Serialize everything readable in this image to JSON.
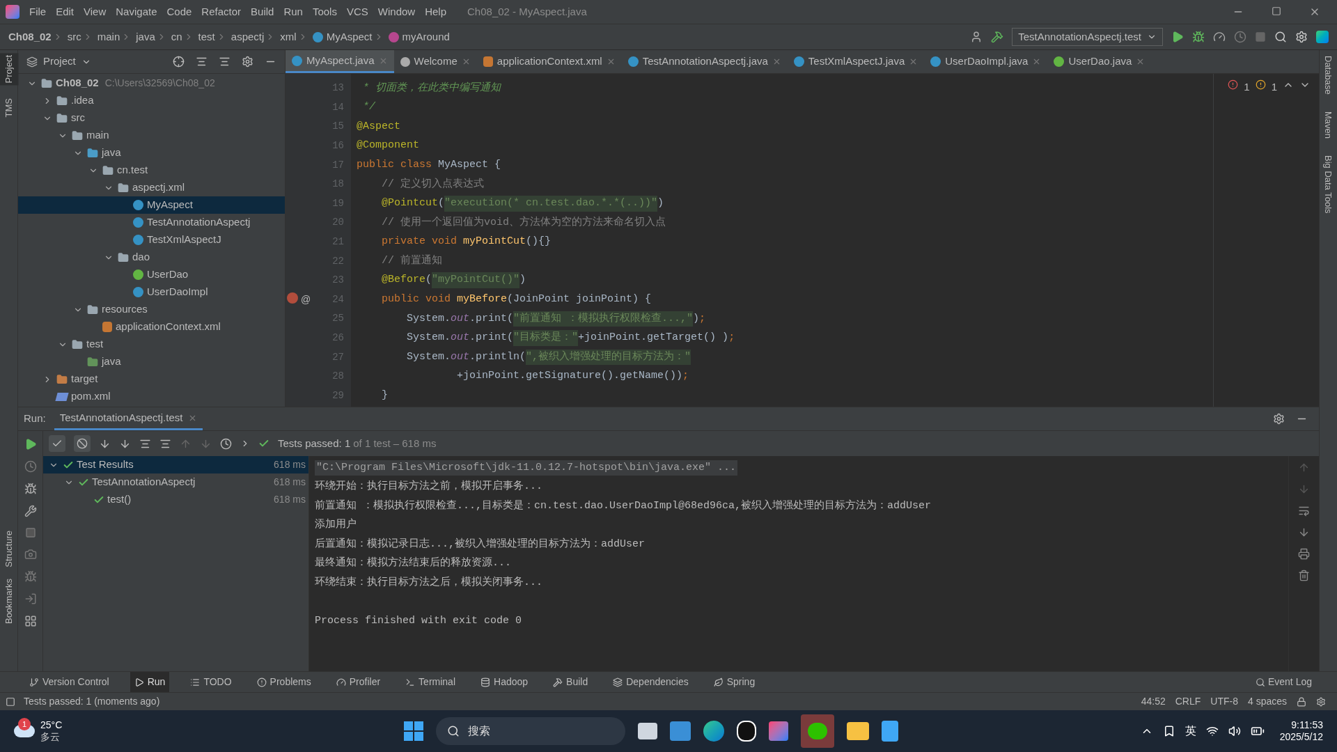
{
  "menu_bar": {
    "items": [
      "File",
      "Edit",
      "View",
      "Navigate",
      "Code",
      "Refactor",
      "Build",
      "Run",
      "Tools",
      "VCS",
      "Window",
      "Help"
    ],
    "title": "Ch08_02 - MyAspect.java"
  },
  "nav_bar": {
    "breadcrumbs": [
      {
        "label": "Ch08_02",
        "kind": "bold"
      },
      {
        "label": "src",
        "kind": "plain"
      },
      {
        "label": "main",
        "kind": "plain"
      },
      {
        "label": "java",
        "kind": "plain"
      },
      {
        "label": "cn",
        "kind": "plain"
      },
      {
        "label": "test",
        "kind": "plain"
      },
      {
        "label": "aspectj",
        "kind": "plain"
      },
      {
        "label": "xml",
        "kind": "plain"
      },
      {
        "label": "MyAspect",
        "kind": "class"
      },
      {
        "label": "myAround",
        "kind": "method"
      }
    ],
    "run_config": "TestAnnotationAspectj.test"
  },
  "left_stripe": {
    "top": [
      "Project",
      "TMS"
    ],
    "bottom": [
      "Structure",
      "Bookmarks"
    ]
  },
  "right_stripe": [
    "Database",
    "Maven",
    "Big Data Tools"
  ],
  "project": {
    "title": "Project",
    "tree": [
      {
        "label": "Ch08_02",
        "path": "C:\\Users\\32569\\Ch08_02",
        "kind": "module",
        "expanded": true,
        "selected": false,
        "children": [
          {
            "label": ".idea",
            "kind": "folder",
            "expanded": false,
            "selected": false
          },
          {
            "label": "src",
            "kind": "folder",
            "expanded": true,
            "selected": false,
            "children": [
              {
                "label": "main",
                "kind": "folder",
                "expanded": true,
                "selected": false,
                "children": [
                  {
                    "label": "java",
                    "kind": "source",
                    "expanded": true,
                    "selected": false,
                    "children": [
                      {
                        "label": "cn.test",
                        "kind": "package",
                        "expanded": true,
                        "selected": false,
                        "children": [
                          {
                            "label": "aspectj.xml",
                            "kind": "package",
                            "expanded": true,
                            "selected": false,
                            "children": [
                              {
                                "label": "MyAspect",
                                "kind": "class",
                                "selected": true
                              },
                              {
                                "label": "TestAnnotationAspectj",
                                "kind": "class",
                                "selected": false
                              },
                              {
                                "label": "TestXmlAspectJ",
                                "kind": "class",
                                "selected": false
                              }
                            ]
                          },
                          {
                            "label": "dao",
                            "kind": "package",
                            "expanded": true,
                            "selected": false,
                            "children": [
                              {
                                "label": "UserDao",
                                "kind": "interface",
                                "selected": false
                              },
                              {
                                "label": "UserDaoImpl",
                                "kind": "class",
                                "selected": false
                              }
                            ]
                          }
                        ]
                      }
                    ]
                  },
                  {
                    "label": "resources",
                    "kind": "resources",
                    "expanded": true,
                    "selected": false,
                    "children": [
                      {
                        "label": "applicationContext.xml",
                        "kind": "xml",
                        "selected": false
                      }
                    ]
                  }
                ]
              },
              {
                "label": "test",
                "kind": "folder",
                "expanded": true,
                "selected": false,
                "children": [
                  {
                    "label": "java",
                    "kind": "testsource",
                    "selected": false
                  }
                ]
              }
            ]
          },
          {
            "label": "target",
            "kind": "excluded",
            "expanded": false,
            "selected": false
          },
          {
            "label": "pom.xml",
            "kind": "maven",
            "selected": false
          }
        ]
      }
    ]
  },
  "editor": {
    "tabs": [
      {
        "label": "MyAspect.java",
        "kind": "class",
        "selected": true
      },
      {
        "label": "Welcome",
        "kind": "info",
        "selected": false
      },
      {
        "label": "applicationContext.xml",
        "kind": "xml",
        "selected": false
      },
      {
        "label": "TestAnnotationAspectj.java",
        "kind": "class",
        "selected": false
      },
      {
        "label": "TestXmlAspectJ.java",
        "kind": "class",
        "selected": false
      },
      {
        "label": "UserDaoImpl.java",
        "kind": "class",
        "selected": false
      },
      {
        "label": "UserDao.java",
        "kind": "interface",
        "selected": false
      }
    ],
    "errors": "1",
    "warnings": "1",
    "lines": [
      {
        "number": "13",
        "segments": [
          {
            "kind": "doc",
            "text": " * 切面类，在此类中编写通知"
          }
        ]
      },
      {
        "number": "14",
        "segments": [
          {
            "kind": "doc",
            "text": " */"
          }
        ]
      },
      {
        "number": "15",
        "segments": [
          {
            "kind": "annotation",
            "text": "@Aspect"
          }
        ]
      },
      {
        "number": "16",
        "segments": [
          {
            "kind": "annotation",
            "text": "@Component"
          }
        ]
      },
      {
        "number": "17",
        "segments": [
          {
            "kind": "keyword",
            "text": "public class "
          },
          {
            "kind": "plain",
            "text": "MyAspect {"
          }
        ]
      },
      {
        "number": "18",
        "segments": [
          {
            "kind": "comment",
            "text": "    // 定义切入点表达式"
          }
        ]
      },
      {
        "number": "19",
        "segments": [
          {
            "kind": "annotation",
            "text": "    @Pointcut"
          },
          {
            "kind": "plain",
            "text": "("
          },
          {
            "kind": "string",
            "text": "\"execution(* cn.test.dao.*.*(..))\""
          },
          {
            "kind": "plain",
            "text": ")"
          }
        ]
      },
      {
        "number": "20",
        "segments": [
          {
            "kind": "comment",
            "text": "    // 使用一个返回值为void、方法体为空的方法来命名切入点"
          }
        ]
      },
      {
        "number": "21",
        "segments": [
          {
            "kind": "keyword",
            "text": "    private void "
          },
          {
            "kind": "method",
            "text": "myPointCut"
          },
          {
            "kind": "plain",
            "text": "(){}"
          }
        ]
      },
      {
        "number": "22",
        "segments": [
          {
            "kind": "comment",
            "text": "    // 前置通知"
          }
        ]
      },
      {
        "number": "23",
        "segments": [
          {
            "kind": "annotation",
            "text": "    @Before"
          },
          {
            "kind": "plain",
            "text": "("
          },
          {
            "kind": "string",
            "text": "\"myPointCut()\""
          },
          {
            "kind": "plain",
            "text": ")"
          }
        ]
      },
      {
        "number": "24",
        "gutter_mark": "@",
        "segments": [
          {
            "kind": "keyword",
            "text": "    public void "
          },
          {
            "kind": "method",
            "text": "myBefore"
          },
          {
            "kind": "plain",
            "text": "(JoinPoint joinPoint) {"
          }
        ]
      },
      {
        "number": "25",
        "segments": [
          {
            "kind": "plain",
            "text": "        System."
          },
          {
            "kind": "static",
            "text": "out"
          },
          {
            "kind": "plain",
            "text": ".print("
          },
          {
            "kind": "string",
            "text": "\"前置通知 ：模拟执行权限检查...,\""
          },
          {
            "kind": "plain",
            "text": ")"
          },
          {
            "kind": "keyword",
            "text": ";"
          }
        ]
      },
      {
        "number": "26",
        "segments": [
          {
            "kind": "plain",
            "text": "        System."
          },
          {
            "kind": "static",
            "text": "out"
          },
          {
            "kind": "plain",
            "text": ".print("
          },
          {
            "kind": "string",
            "text": "\"目标类是：\""
          },
          {
            "kind": "plain",
            "text": "+joinPoint.getTarget() )"
          },
          {
            "kind": "keyword",
            "text": ";"
          }
        ]
      },
      {
        "number": "27",
        "segments": [
          {
            "kind": "plain",
            "text": "        System."
          },
          {
            "kind": "static",
            "text": "out"
          },
          {
            "kind": "plain",
            "text": ".println("
          },
          {
            "kind": "string",
            "text": "\",被织入增强处理的目标方法为：\""
          }
        ]
      },
      {
        "number": "28",
        "segments": [
          {
            "kind": "plain",
            "text": "                +joinPoint.getSignature().getName())"
          },
          {
            "kind": "keyword",
            "text": ";"
          }
        ]
      },
      {
        "number": "29",
        "segments": [
          {
            "kind": "plain",
            "text": "    }"
          }
        ]
      }
    ]
  },
  "run_panel": {
    "label": "Run:",
    "tab": "TestAnnotationAspectj.test",
    "status_main": "Tests passed: 1",
    "status_rest": "of 1 test – 618 ms",
    "results": [
      {
        "label": "Test Results",
        "time": "618 ms",
        "selected": true,
        "children": [
          {
            "label": "TestAnnotationAspectj",
            "time": "618 ms",
            "selected": false,
            "children": [
              {
                "label": "test()",
                "time": "618 ms",
                "selected": false
              }
            ]
          }
        ]
      }
    ],
    "console": [
      {
        "kind": "command",
        "text": "\"C:\\Program Files\\Microsoft\\jdk-11.0.12.7-hotspot\\bin\\java.exe\" ..."
      },
      {
        "kind": "output",
        "text": "环绕开始：执行目标方法之前，模拟开启事务..."
      },
      {
        "kind": "output",
        "text": "前置通知 ：模拟执行权限检查...,目标类是：cn.test.dao.UserDaoImpl@68ed96ca,被织入增强处理的目标方法为：addUser"
      },
      {
        "kind": "output",
        "text": "添加用户"
      },
      {
        "kind": "output",
        "text": "后置通知：模拟记录日志...,被织入增强处理的目标方法为：addUser"
      },
      {
        "kind": "output",
        "text": "最终通知：模拟方法结束后的释放资源..."
      },
      {
        "kind": "output",
        "text": "环绕结束：执行目标方法之后，模拟关闭事务..."
      },
      {
        "kind": "blank"
      },
      {
        "kind": "output",
        "text": "Process finished with exit code 0"
      }
    ]
  },
  "tool_strip": {
    "items": [
      {
        "label": "Version Control",
        "selected": false
      },
      {
        "label": "Run",
        "selected": true
      },
      {
        "label": "TODO",
        "selected": false
      },
      {
        "label": "Problems",
        "selected": false
      },
      {
        "label": "Profiler",
        "selected": false
      },
      {
        "label": "Terminal",
        "selected": false
      },
      {
        "label": "Hadoop",
        "selected": false
      },
      {
        "label": "Build",
        "selected": false
      },
      {
        "label": "Dependencies",
        "selected": false
      },
      {
        "label": "Spring",
        "selected": false
      }
    ],
    "event_log": "Event Log"
  },
  "status_bar": {
    "message": "Tests passed: 1 (moments ago)",
    "items": [
      "44:52",
      "CRLF",
      "UTF-8",
      "4 spaces"
    ]
  },
  "taskbar": {
    "temperature": "25°C",
    "weather": "多云",
    "weather_badge": "1",
    "search_placeholder": "搜索",
    "ime": "英",
    "time": "9:11:53",
    "date": "2025/5/12"
  }
}
